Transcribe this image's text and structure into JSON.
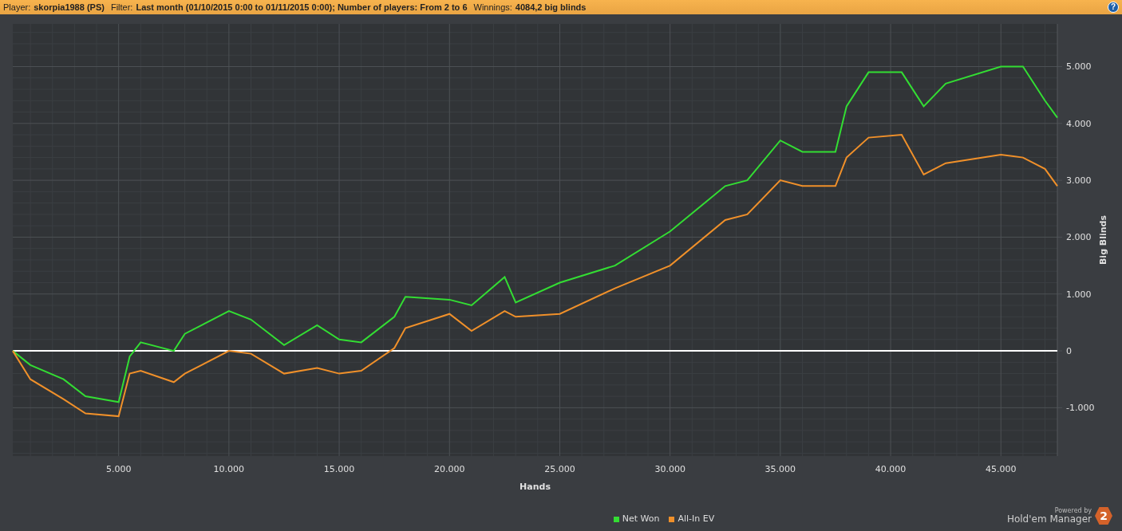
{
  "header": {
    "fields": [
      {
        "label": "Player:",
        "value": "skorpia1988 (PS)"
      },
      {
        "label": "Filter:",
        "value": "Last month (01/10/2015 0:00 to 01/11/2015 0:00); Number of players: From 2 to 6"
      },
      {
        "label": "Winnings:",
        "value": "4084,2 big blinds"
      }
    ],
    "help_label": "?"
  },
  "chart_data": {
    "type": "line",
    "xlabel": "Hands",
    "ylabel": "Big Blinds",
    "xlim": [
      200,
      47560
    ],
    "ylim": [
      -1850,
      5750
    ],
    "grid": true,
    "x": [
      200,
      1000,
      2500,
      3500,
      5000,
      5500,
      6000,
      7500,
      8000,
      10000,
      11000,
      12500,
      14000,
      15000,
      16000,
      17500,
      18000,
      20000,
      21000,
      22500,
      23000,
      25000,
      27500,
      30000,
      32500,
      33500,
      35000,
      36000,
      37500,
      38000,
      39000,
      40500,
      41500,
      42500,
      45000,
      46000,
      47000,
      47560
    ],
    "series": [
      {
        "name": "Net Won",
        "color": "#33dd33",
        "values": [
          0,
          -250,
          -500,
          -800,
          -900,
          -100,
          150,
          0,
          300,
          700,
          550,
          100,
          450,
          200,
          150,
          600,
          950,
          900,
          800,
          1300,
          850,
          1200,
          1500,
          2100,
          2900,
          3000,
          3700,
          3500,
          3500,
          4300,
          4900,
          4900,
          4300,
          4700,
          5000,
          5000,
          4400,
          4100
        ]
      },
      {
        "name": "All-In EV",
        "color": "#f0902a",
        "values": [
          0,
          -500,
          -850,
          -1100,
          -1150,
          -400,
          -350,
          -550,
          -400,
          0,
          -50,
          -400,
          -300,
          -400,
          -350,
          50,
          400,
          650,
          350,
          700,
          600,
          650,
          1100,
          1500,
          2300,
          2400,
          3000,
          2900,
          2900,
          3400,
          3750,
          3800,
          3100,
          3300,
          3450,
          3400,
          3200,
          2900
        ]
      }
    ],
    "xticks": [
      {
        "value": 5000,
        "label": "5.000"
      },
      {
        "value": 10000,
        "label": "10.000"
      },
      {
        "value": 15000,
        "label": "15.000"
      },
      {
        "value": 20000,
        "label": "20.000"
      },
      {
        "value": 25000,
        "label": "25.000"
      },
      {
        "value": 30000,
        "label": "30.000"
      },
      {
        "value": 35000,
        "label": "35.000"
      },
      {
        "value": 40000,
        "label": "40.000"
      },
      {
        "value": 45000,
        "label": "45.000"
      }
    ],
    "yticks": [
      {
        "value": -1000,
        "label": "-1.000"
      },
      {
        "value": 0,
        "label": "0"
      },
      {
        "value": 1000,
        "label": "1.000"
      },
      {
        "value": 2000,
        "label": "2.000"
      },
      {
        "value": 3000,
        "label": "3.000"
      },
      {
        "value": 4000,
        "label": "4.000"
      },
      {
        "value": 5000,
        "label": "5.000"
      }
    ]
  },
  "branding": {
    "caption": "Powered by",
    "product": "Hold'em Manager",
    "badge": "2"
  }
}
